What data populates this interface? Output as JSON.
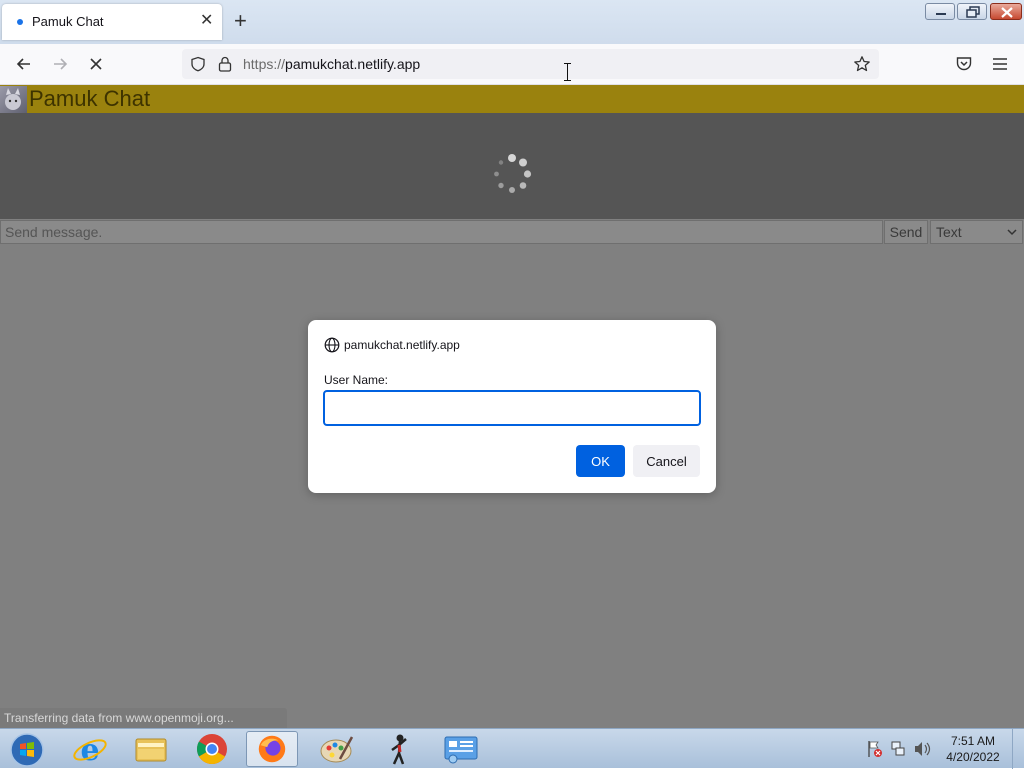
{
  "browser": {
    "tab": {
      "title": "Pamuk Chat"
    },
    "url": {
      "scheme": "https://",
      "host": "pamukchat.netlify.app"
    }
  },
  "chat": {
    "title": "Pamuk Chat",
    "message_placeholder": "Send message.",
    "send_label": "Send",
    "type_select": {
      "selected": "Text"
    }
  },
  "dialog": {
    "origin": "pamukchat.netlify.app",
    "label": "User Name:",
    "value": "",
    "ok_label": "OK",
    "cancel_label": "Cancel"
  },
  "status": {
    "text": "Transferring data from www.openmoji.org..."
  },
  "taskbar": {
    "time": "7:51 AM",
    "date": "4/20/2022",
    "apps": [
      "start-orb",
      "internet-explorer-icon",
      "file-explorer-icon",
      "chrome-icon",
      "firefox-icon",
      "paint-icon",
      "stick-figure-app-icon",
      "control-panel-icon"
    ]
  },
  "colors": {
    "chat_header": "#9a820e",
    "messages_bg": "#555555",
    "overlay_bg": "#808080",
    "accent": "#0061e0"
  }
}
